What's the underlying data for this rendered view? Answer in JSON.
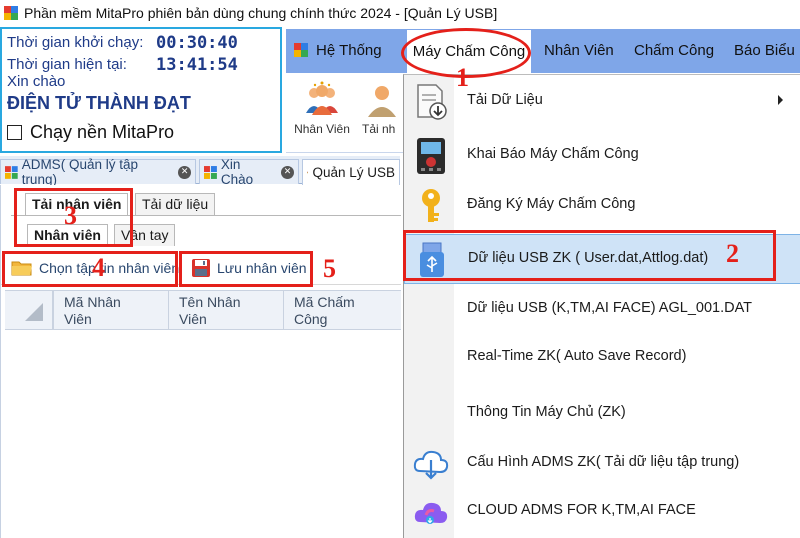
{
  "window": {
    "title": "Phần mềm MitaPro phiên bản dùng chung chính thức 2024 - [Quản Lý USB]"
  },
  "info": {
    "start_label": "Thời gian khởi chạy:",
    "start_value": "00:30:40",
    "now_label": "Thời gian hiện tại:",
    "now_value": "13:41:54",
    "greeting": "Xin chào",
    "company": "ĐIỆN TỬ THÀNH ĐẠT",
    "background_label": "Chạy nền MitaPro",
    "background_checked": false
  },
  "ribbon": {
    "tabs": [
      {
        "label": "Hệ Thống"
      },
      {
        "label": "Máy Chấm Công"
      },
      {
        "label": "Nhân Viên"
      },
      {
        "label": "Chấm Công"
      },
      {
        "label": "Báo Biểu"
      }
    ],
    "active_tab": "Máy Chấm Công",
    "buttons": [
      {
        "label": "Nhân Viên",
        "icon": "staff-group-icon"
      },
      {
        "label": "Tải nh",
        "icon": "staff-download-icon"
      }
    ]
  },
  "doc_tabs": [
    {
      "label": "ADMS( Quản lý tập trung)"
    },
    {
      "label": "Xin Chào"
    },
    {
      "label": "Quản Lý USB"
    }
  ],
  "content": {
    "top_tabs": [
      {
        "label": "Tải nhân viên"
      },
      {
        "label": "Tải dữ liệu"
      }
    ],
    "sub_tabs": [
      {
        "label": "Nhân viên"
      },
      {
        "label": "Vân tay"
      }
    ],
    "toolbar": {
      "choose_label": "Chọn tập tin nhân viên",
      "save_label": "Lưu nhân viên"
    },
    "columns": [
      {
        "line1": "Mã Nhân",
        "line2": "Viên"
      },
      {
        "line1": "Tên Nhân",
        "line2": "Viên"
      },
      {
        "line1": "Mã Chấm",
        "line2": "Công"
      }
    ]
  },
  "menu": {
    "items": [
      {
        "label": "Tải Dữ Liệu",
        "icon": "document-download-icon",
        "submenu": true
      },
      {
        "label": "Khai Báo Máy Chấm Công",
        "icon": "attendance-device-icon"
      },
      {
        "label": "Đăng Ký Máy Chấm Công",
        "icon": "key-icon"
      },
      {
        "label": "Dữ liệu USB ZK ( User.dat,Attlog.dat)",
        "icon": "usb-drive-icon",
        "highlighted": true
      },
      {
        "label": "Dữ liệu USB (K,TM,AI FACE) AGL_001.DAT",
        "icon": ""
      },
      {
        "label": "Real-Time ZK( Auto Save Record)",
        "icon": ""
      },
      {
        "label": "Thông Tin Máy Chủ (ZK)",
        "icon": ""
      },
      {
        "label": "Cấu Hình ADMS ZK( Tải dữ liệu tập trung)",
        "icon": "cloud-download-icon"
      },
      {
        "label": "CLOUD ADMS FOR K,TM,AI FACE",
        "icon": "cloud-color-icon"
      }
    ]
  },
  "annotations": {
    "step1": "1",
    "step2": "2",
    "step3": "3",
    "step4": "4",
    "step5": "5",
    "color": "#e4201a"
  },
  "colors": {
    "ribbon": "#7fa6e8",
    "menu_highlight": "#cfe3f7",
    "text_blue": "#1f3b88"
  }
}
